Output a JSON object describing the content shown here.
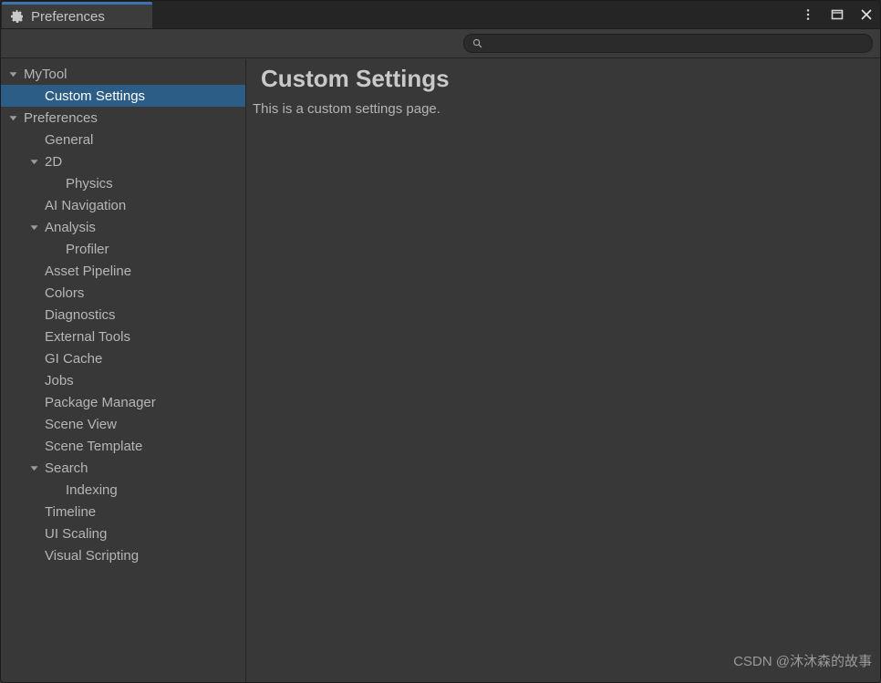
{
  "window": {
    "tab_title": "Preferences",
    "tab_icon": "gear-icon",
    "accent_color": "#3c72b0",
    "controls": [
      {
        "name": "more-options-icon",
        "label": "⋮"
      },
      {
        "name": "maximize-icon",
        "label": "▢"
      },
      {
        "name": "close-icon",
        "label": "✕"
      }
    ]
  },
  "toolbar": {
    "search": {
      "icon": "search-icon",
      "value": "",
      "placeholder": ""
    }
  },
  "sidebar": {
    "selected": "Custom Settings",
    "selection_color": "#2c5d87",
    "items": [
      {
        "label": "MyTool",
        "depth": 0,
        "expandable": true,
        "expanded": true,
        "selected": false
      },
      {
        "label": "Custom Settings",
        "depth": 1,
        "expandable": false,
        "expanded": false,
        "selected": true
      },
      {
        "label": "Preferences",
        "depth": 0,
        "expandable": true,
        "expanded": true,
        "selected": false
      },
      {
        "label": "General",
        "depth": 1,
        "expandable": false,
        "expanded": false,
        "selected": false
      },
      {
        "label": "2D",
        "depth": 1,
        "expandable": true,
        "expanded": true,
        "selected": false
      },
      {
        "label": "Physics",
        "depth": 2,
        "expandable": false,
        "expanded": false,
        "selected": false
      },
      {
        "label": "AI Navigation",
        "depth": 1,
        "expandable": false,
        "expanded": false,
        "selected": false
      },
      {
        "label": "Analysis",
        "depth": 1,
        "expandable": true,
        "expanded": true,
        "selected": false
      },
      {
        "label": "Profiler",
        "depth": 2,
        "expandable": false,
        "expanded": false,
        "selected": false
      },
      {
        "label": "Asset Pipeline",
        "depth": 1,
        "expandable": false,
        "expanded": false,
        "selected": false
      },
      {
        "label": "Colors",
        "depth": 1,
        "expandable": false,
        "expanded": false,
        "selected": false
      },
      {
        "label": "Diagnostics",
        "depth": 1,
        "expandable": false,
        "expanded": false,
        "selected": false
      },
      {
        "label": "External Tools",
        "depth": 1,
        "expandable": false,
        "expanded": false,
        "selected": false
      },
      {
        "label": "GI Cache",
        "depth": 1,
        "expandable": false,
        "expanded": false,
        "selected": false
      },
      {
        "label": "Jobs",
        "depth": 1,
        "expandable": false,
        "expanded": false,
        "selected": false
      },
      {
        "label": "Package Manager",
        "depth": 1,
        "expandable": false,
        "expanded": false,
        "selected": false
      },
      {
        "label": "Scene View",
        "depth": 1,
        "expandable": false,
        "expanded": false,
        "selected": false
      },
      {
        "label": "Scene Template",
        "depth": 1,
        "expandable": false,
        "expanded": false,
        "selected": false
      },
      {
        "label": "Search",
        "depth": 1,
        "expandable": true,
        "expanded": true,
        "selected": false
      },
      {
        "label": "Indexing",
        "depth": 2,
        "expandable": false,
        "expanded": false,
        "selected": false
      },
      {
        "label": "Timeline",
        "depth": 1,
        "expandable": false,
        "expanded": false,
        "selected": false
      },
      {
        "label": "UI Scaling",
        "depth": 1,
        "expandable": false,
        "expanded": false,
        "selected": false
      },
      {
        "label": "Visual Scripting",
        "depth": 1,
        "expandable": false,
        "expanded": false,
        "selected": false
      }
    ]
  },
  "main": {
    "title": "Custom Settings",
    "description": "This is a custom settings page."
  },
  "watermark": {
    "text": "CSDN @沐沐森的故事"
  }
}
